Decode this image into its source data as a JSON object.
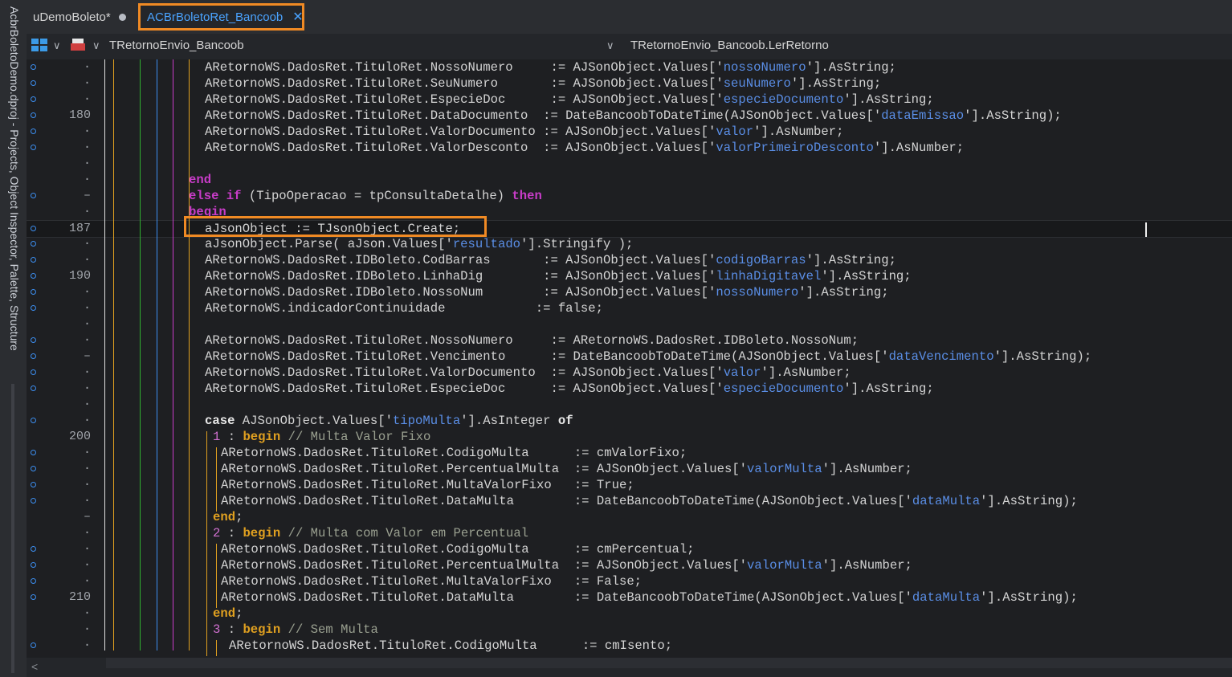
{
  "side_panel": {
    "label": "AcbrBoletoDemo.dproj - Projects, Object Inspector, Palette, Structure"
  },
  "tabs": [
    {
      "label": "uDemoBoleto*"
    },
    {
      "label": "ACBrBoletoRet_Bancoob",
      "close": "✕"
    }
  ],
  "toolbar": {
    "class_selector": "TRetornoEnvio_Bancoob",
    "method_selector": "TRetornoEnvio_Bancoob.LerRetorno",
    "icons": [
      "grid-icon",
      "print-icon"
    ]
  },
  "editor": {
    "current_line": 187,
    "lines": [
      {
        "n": "·",
        "bp": true,
        "indent": 0,
        "html": "ARetornoWS.DadosRet.TituloRet.NossoNumero     := AJSonObject.Values['<s>nossoNumero</s>'].AsString;"
      },
      {
        "n": "·",
        "bp": true,
        "indent": 0,
        "html": "ARetornoWS.DadosRet.TituloRet.SeuNumero       := AJSonObject.Values['<s>seuNumero</s>'].AsString;"
      },
      {
        "n": "·",
        "bp": true,
        "indent": 0,
        "html": "ARetornoWS.DadosRet.TituloRet.EspecieDoc      := AJSonObject.Values['<s>especieDocumento</s>'].AsString;"
      },
      {
        "n": "180",
        "bp": true,
        "indent": 0,
        "html": "ARetornoWS.DadosRet.TituloRet.DataDocumento  := DateBancoobToDateTime(AJSonObject.Values['<s>dataEmissao</s>'].AsString);"
      },
      {
        "n": "·",
        "bp": true,
        "indent": 0,
        "html": "ARetornoWS.DadosRet.TituloRet.ValorDocumento := AJSonObject.Values['<s>valor</s>'].AsNumber;"
      },
      {
        "n": "·",
        "bp": true,
        "indent": 0,
        "html": "ARetornoWS.DadosRet.TituloRet.ValorDesconto  := AJSonObject.Values['<s>valorPrimeiroDesconto</s>'].AsNumber;"
      },
      {
        "n": "·",
        "bp": false,
        "indent": 0,
        "html": ""
      },
      {
        "n": "·",
        "bp": false,
        "indent": -2,
        "html": "<k>end</k>"
      },
      {
        "n": "–",
        "bp": true,
        "indent": -2,
        "html": "<k>else</k> <k>if</k> (TipoOperacao = tpConsultaDetalhe) <k>then</k>"
      },
      {
        "n": "·",
        "bp": false,
        "indent": -2,
        "html": "<k>begin</k>"
      },
      {
        "n": "187",
        "bp": true,
        "indent": 0,
        "html": "aJsonObject := TJsonObject.Create;"
      },
      {
        "n": "·",
        "bp": true,
        "indent": 0,
        "html": "aJsonObject.Parse( aJson.Values['<s>resultado</s>'].Stringify );"
      },
      {
        "n": "·",
        "bp": true,
        "indent": 0,
        "html": "ARetornoWS.DadosRet.IDBoleto.CodBarras       := AJSonObject.Values['<s>codigoBarras</s>'].AsString;"
      },
      {
        "n": "190",
        "bp": true,
        "indent": 0,
        "html": "ARetornoWS.DadosRet.IDBoleto.LinhaDig        := AJSonObject.Values['<s>linhaDigitavel</s>'].AsString;"
      },
      {
        "n": "·",
        "bp": true,
        "indent": 0,
        "html": "ARetornoWS.DadosRet.IDBoleto.NossoNum        := AJSonObject.Values['<s>nossoNumero</s>'].AsString;"
      },
      {
        "n": "·",
        "bp": true,
        "indent": 0,
        "html": "ARetornoWS.indicadorContinuidade            := false;"
      },
      {
        "n": "·",
        "bp": false,
        "indent": 0,
        "html": ""
      },
      {
        "n": "·",
        "bp": true,
        "indent": 0,
        "html": "ARetornoWS.DadosRet.TituloRet.NossoNumero     := ARetornoWS.DadosRet.IDBoleto.NossoNum;"
      },
      {
        "n": "–",
        "bp": true,
        "indent": 0,
        "html": "ARetornoWS.DadosRet.TituloRet.Vencimento      := DateBancoobToDateTime(AJSonObject.Values['<s>dataVencimento</s>'].AsString);"
      },
      {
        "n": "·",
        "bp": true,
        "indent": 0,
        "html": "ARetornoWS.DadosRet.TituloRet.ValorDocumento  := AJSonObject.Values['<s>valor</s>'].AsNumber;"
      },
      {
        "n": "·",
        "bp": true,
        "indent": 0,
        "html": "ARetornoWS.DadosRet.TituloRet.EspecieDoc      := AJSonObject.Values['<s>especieDocumento</s>'].AsString;"
      },
      {
        "n": "·",
        "bp": false,
        "indent": 0,
        "html": ""
      },
      {
        "n": "·",
        "bp": true,
        "indent": 0,
        "html": "<w>case</w> AJSonObject.Values['<s>tipoMulta</s>'].AsInteger <w>of</w>"
      },
      {
        "n": "200",
        "bp": false,
        "indent": 1,
        "html": "<n>1</n> : <o>begin</o> <c>// Multa Valor Fixo</c>"
      },
      {
        "n": "·",
        "bp": true,
        "indent": 2,
        "html": "ARetornoWS.DadosRet.TituloRet.CodigoMulta      := cmValorFixo;"
      },
      {
        "n": "·",
        "bp": true,
        "indent": 2,
        "html": "ARetornoWS.DadosRet.TituloRet.PercentualMulta  := AJSonObject.Values['<s>valorMulta</s>'].AsNumber;"
      },
      {
        "n": "·",
        "bp": true,
        "indent": 2,
        "html": "ARetornoWS.DadosRet.TituloRet.MultaValorFixo   := True;"
      },
      {
        "n": "·",
        "bp": true,
        "indent": 2,
        "html": "ARetornoWS.DadosRet.TituloRet.DataMulta        := DateBancoobToDateTime(AJSonObject.Values['<s>dataMulta</s>'].AsString);"
      },
      {
        "n": "–",
        "bp": false,
        "indent": 1,
        "html": "<o>end</o>;"
      },
      {
        "n": "·",
        "bp": false,
        "indent": 1,
        "html": "<n>2</n> : <o>begin</o> <c>// Multa com Valor em Percentual</c>"
      },
      {
        "n": "·",
        "bp": true,
        "indent": 2,
        "html": "ARetornoWS.DadosRet.TituloRet.CodigoMulta      := cmPercentual;"
      },
      {
        "n": "·",
        "bp": true,
        "indent": 2,
        "html": "ARetornoWS.DadosRet.TituloRet.PercentualMulta  := AJSonObject.Values['<s>valorMulta</s>'].AsNumber;"
      },
      {
        "n": "·",
        "bp": true,
        "indent": 2,
        "html": "ARetornoWS.DadosRet.TituloRet.MultaValorFixo   := False;"
      },
      {
        "n": "210",
        "bp": true,
        "indent": 2,
        "html": "ARetornoWS.DadosRet.TituloRet.DataMulta        := DateBancoobToDateTime(AJSonObject.Values['<s>dataMulta</s>'].AsString);"
      },
      {
        "n": "·",
        "bp": false,
        "indent": 1,
        "html": "<o>end</o>;"
      },
      {
        "n": "·",
        "bp": false,
        "indent": 1,
        "html": "<n>3</n> : <o>begin</o> <c>// Sem Multa</c>"
      },
      {
        "n": "·",
        "bp": true,
        "indent": 3,
        "html": "ARetornoWS.DadosRet.TituloRet.CodigoMulta      := cmIsento;"
      }
    ]
  },
  "guide_colors": [
    "#e0e0e0",
    "#e0a020",
    "#30b030",
    "#3c8ef0",
    "#c83cc8",
    "#e0a020"
  ],
  "scroll": {
    "left_arrow": "<"
  }
}
